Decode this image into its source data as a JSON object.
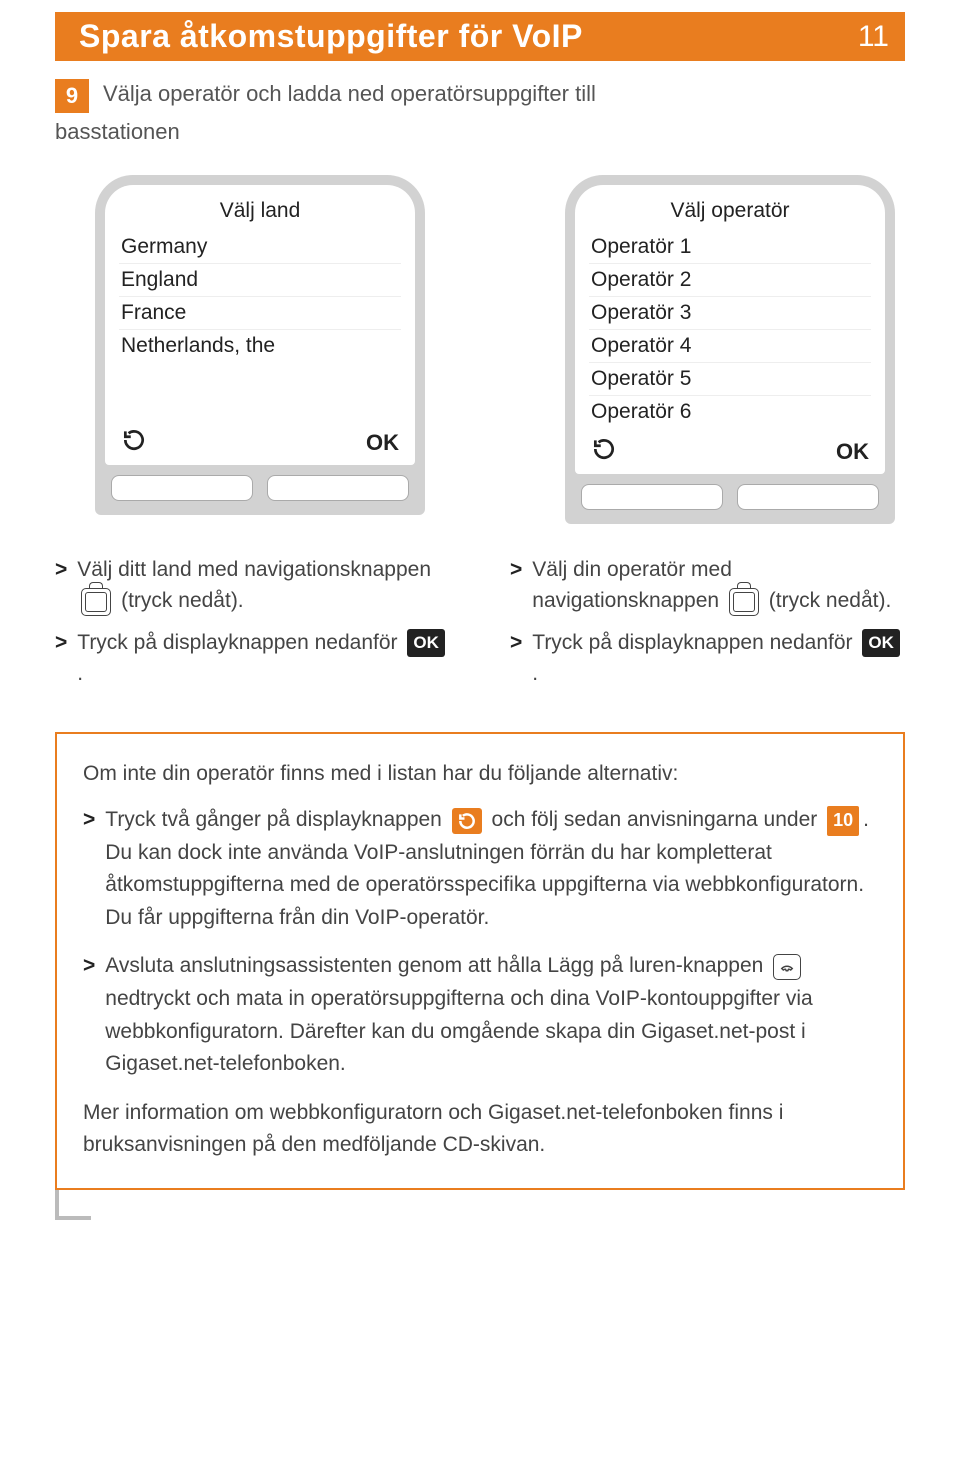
{
  "header": {
    "title": "Spara åtkomstuppgifter för VoIP",
    "page_number": "11"
  },
  "step": {
    "badge": "9",
    "text_line1": "Välja operatör och ladda ned operatörsuppgifter till",
    "text_line2": "basstationen"
  },
  "screen_left": {
    "title": "Välj land",
    "items": [
      "Germany",
      "England",
      "France",
      "Netherlands, the"
    ],
    "softkey_ok": "OK"
  },
  "screen_right": {
    "title": "Välj operatör",
    "items": [
      "Operatör 1",
      "Operatör 2",
      "Operatör 3",
      "Operatör 4",
      "Operatör 5",
      "Operatör 6"
    ],
    "softkey_ok": "OK"
  },
  "instr_left": {
    "a_pre": "Välj ditt land med navigationsknappen ",
    "a_post": " (tryck nedåt).",
    "b_pre": "Tryck på displayknappen nedanför ",
    "b_ok": "OK",
    "b_post": "."
  },
  "instr_right": {
    "a_pre": "Välj din operatör med navigationsknappen ",
    "a_post": " (tryck nedåt).",
    "b_pre": "Tryck på displayknappen nedanför ",
    "b_ok": "OK",
    "b_post": "."
  },
  "infobox": {
    "intro": "Om inte din operatör finns med i listan har du följande alternativ:",
    "i1_pre": "Tryck två gånger på displayknappen ",
    "i1_mid": " och följ sedan anvisningarna under ",
    "i1_ref": "10",
    "i1_post": ". Du kan dock inte använda VoIP-anslutningen förrän du har kompletterat åtkomstuppgifterna med de operatörsspecifika uppgifterna via webbkonfiguratorn. Du får uppgifterna från din VoIP-operatör.",
    "i2_pre": "Avsluta anslutningsassistenten genom att hålla Lägg på luren-knappen ",
    "i2_post": " nedtryckt och mata in operatörsuppgifterna och dina VoIP-kontouppgifter via webbkonfiguratorn. Därefter kan du omgående skapa din Gigaset.net-post i Gigaset.net-telefonboken.",
    "closing": "Mer information om webbkonfiguratorn och Gigaset.net-telefonboken finns i bruksanvisningen på den medföljande CD-skivan."
  }
}
